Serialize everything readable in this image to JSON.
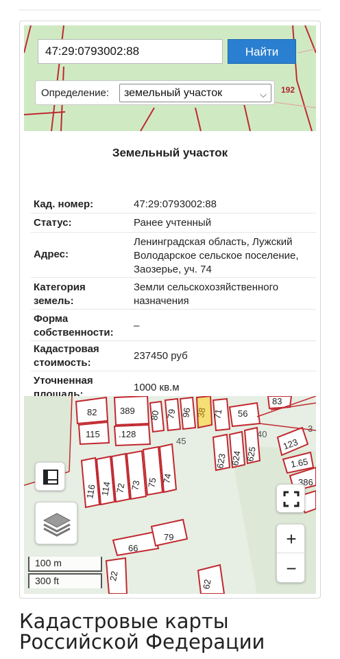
{
  "search": {
    "value": "47:29:0793002:88",
    "button_label": "Найти"
  },
  "definition": {
    "label": "Определение:",
    "selected": "земельный участок"
  },
  "top_map": {
    "label_192": "192"
  },
  "info": {
    "title": "Земельный участок",
    "rows": [
      {
        "key": "Кад. номер",
        "value": "47:29:0793002:88"
      },
      {
        "key": "Статус",
        "value": "Ранее учтенный"
      },
      {
        "key": "Адрес",
        "value": "Ленинградская область, Лужский Володарское сельское поселение, Заозерье, уч. 74"
      },
      {
        "key": "Категория земель",
        "value": "Земли сельскохозяйственного назначения"
      },
      {
        "key": "Форма собственности",
        "value": "–"
      },
      {
        "key": "Кадастровая стоимость",
        "value": "237450 руб"
      },
      {
        "key": "Уточненная площадь",
        "value": "1000 кв.м"
      }
    ]
  },
  "map": {
    "parcel_labels": [
      "82",
      "389",
      "80",
      "79",
      "96",
      "38",
      "71",
      "56",
      "83",
      "115",
      ".128",
      "45",
      "623",
      "624",
      "625",
      "40",
      "123",
      "116",
      "114",
      "72",
      "73",
      "75",
      "74",
      "1.65",
      "386",
      "66",
      "79",
      "22",
      "62",
      "3"
    ],
    "controls": {
      "measure_icon": "ruler-icon",
      "layers_icon": "layers-icon",
      "fullscreen_icon": "fullscreen-icon",
      "zoom_in": "+",
      "zoom_out": "−"
    },
    "scale": {
      "metric": "100 m",
      "imperial": "300 ft"
    }
  },
  "page_heading": "Кадастровые карты Российской Федерации",
  "colors": {
    "accent": "#2a7fd0",
    "parcel_border": "#c0282f",
    "map_green": "#cfeac3",
    "selected_parcel": "#f6df74"
  }
}
